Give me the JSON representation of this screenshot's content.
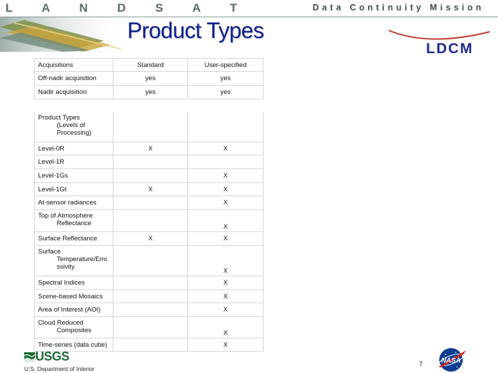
{
  "header": {
    "left_banner": "L A N D S A T",
    "right_banner": "Data Continuity Mission",
    "title": "Product Types",
    "logo": "LDCM"
  },
  "table": {
    "rows": [
      {
        "label": "Acquisitions",
        "label_continued": "",
        "standard": "Standard",
        "user": "User-specified"
      },
      {
        "label": "Off-nadir acquisition",
        "label_continued": "",
        "standard": "yes",
        "user": "yes"
      },
      {
        "label": "Nadir acquisition",
        "label_continued": "",
        "standard": "yes",
        "user": "yes"
      },
      {
        "label": "Product Types",
        "label_continued": "(Levels of Processing)",
        "standard": "",
        "user": ""
      },
      {
        "label": "Level-0R",
        "label_continued": "",
        "standard": "X",
        "user": "X"
      },
      {
        "label": "Level-1R",
        "label_continued": "",
        "standard": "",
        "user": ""
      },
      {
        "label": "Level-1Gs",
        "label_continued": "",
        "standard": "",
        "user": "X"
      },
      {
        "label": "Level-1Gt",
        "label_continued": "",
        "standard": "X",
        "user": "X"
      },
      {
        "label": "At-sensor radiances",
        "label_continued": "",
        "standard": "",
        "user": "X"
      },
      {
        "label": "Top of Atmosphere",
        "label_continued": "Reflectance",
        "standard": "",
        "user": "X"
      },
      {
        "label": "Surface Reflectance",
        "label_continued": "",
        "standard": "X",
        "user": "X"
      },
      {
        "label": "Surface",
        "label_continued": "Temperature/Emi ssivity",
        "standard": "",
        "user": "X"
      },
      {
        "label": "Spectral Indices",
        "label_continued": "",
        "standard": "",
        "user": "X"
      },
      {
        "label": "Scene-based Mosaics",
        "label_continued": "",
        "standard": "",
        "user": "X"
      },
      {
        "label": "Area of Interest (AOI)",
        "label_continued": "",
        "standard": "",
        "user": "X"
      },
      {
        "label": "Cloud Reduced",
        "label_continued": "Composites",
        "standard": "",
        "user": "X"
      },
      {
        "label": "Time-series (data cube)",
        "label_continued": "",
        "standard": "",
        "user": "X"
      }
    ]
  },
  "footer": {
    "agency_logo_text": "USGS",
    "department": "U.S. Department of Interior",
    "page_number": "7",
    "nasa_logo_text": "NASA"
  },
  "colors": {
    "title": "#0f1f8c",
    "logo": "#1c2a8c",
    "usgs_green": "#1a6b33",
    "nasa_blue": "#0b3d91",
    "nasa_red": "#d52b1e"
  }
}
